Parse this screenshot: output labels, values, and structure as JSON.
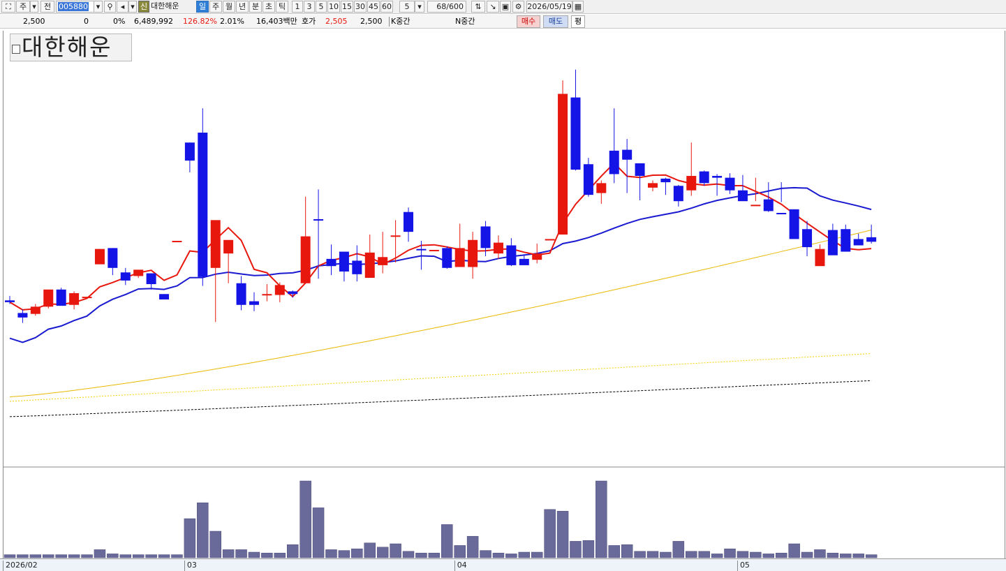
{
  "toolbar": {
    "period_label": "주",
    "view_label": "전",
    "code_value": "005880",
    "badge_label": "신",
    "stock_name": "대한해운",
    "timeframes": [
      "일",
      "주",
      "월",
      "년",
      "분",
      "초",
      "틱"
    ],
    "active_timeframe": "일",
    "intervals": [
      "1",
      "3",
      "5",
      "10",
      "15",
      "30",
      "45",
      "60"
    ],
    "interval_value": "5",
    "count_display": "68/600",
    "date_value": "2026/05/19"
  },
  "quote": {
    "price": "2,500",
    "change": "0",
    "change_rate": "0%",
    "volume": "6,489,992",
    "volume_ratio": "126.82%",
    "turnover": "2.01%",
    "amount": "16,403백만",
    "ask_label": "호가",
    "ask": "2,505",
    "bid": "2,500",
    "k_label": "K중간",
    "n_label": "N중간",
    "buy_label": "매수",
    "sell_label": "매도",
    "avg_label": "평"
  },
  "title": "대한해운",
  "colors": {
    "up": "#e8170e",
    "down": "#1414e6",
    "ma5": "#e8170e",
    "ma20": "#1a1ad0",
    "ma60": "#e8b800",
    "ma120": "#f5d000",
    "ma240": "#000000",
    "volume": "#6a6a9a"
  },
  "chart_data": {
    "type": "candlestick",
    "x_labels": [
      {
        "label": "2026/02",
        "index": 0
      },
      {
        "label": "03",
        "index": 14
      },
      {
        "label": "04",
        "index": 35
      },
      {
        "label": "05",
        "index": 57
      }
    ],
    "ohlc": [
      [
        2226,
        2231,
        2222,
        2224
      ],
      [
        2212,
        2216,
        2201,
        2207
      ],
      [
        2211,
        2222,
        2209,
        2219
      ],
      [
        2219,
        2238,
        2217,
        2238
      ],
      [
        2238,
        2240,
        2220,
        2220
      ],
      [
        2221,
        2236,
        2216,
        2234
      ],
      [
        2230,
        2230,
        2230,
        2230
      ],
      [
        2266,
        2283,
        2266,
        2283
      ],
      [
        2284,
        2284,
        2254,
        2262
      ],
      [
        2257,
        2262,
        2243,
        2248
      ],
      [
        2253,
        2260,
        2251,
        2260
      ],
      [
        2256,
        2256,
        2238,
        2244
      ],
      [
        2233,
        2233,
        2228,
        2227
      ],
      [
        2292,
        2292,
        2292,
        2292
      ],
      [
        2401,
        2401,
        2368,
        2381
      ],
      [
        2412,
        2439,
        2242,
        2252
      ],
      [
        2262,
        2291,
        2202,
        2315
      ],
      [
        2278,
        2281,
        2245,
        2293
      ],
      [
        2245,
        2253,
        2215,
        2221
      ],
      [
        2225,
        2235,
        2214,
        2221
      ],
      [
        2233,
        2244,
        2225,
        2233
      ],
      [
        2232,
        2246,
        2224,
        2243
      ],
      [
        2236,
        2237,
        2229,
        2233
      ],
      [
        2245,
        2341,
        2245,
        2297
      ],
      [
        2316,
        2349,
        2250,
        2315
      ],
      [
        2272,
        2288,
        2254,
        2264
      ],
      [
        2280,
        2280,
        2247,
        2258
      ],
      [
        2270,
        2287,
        2247,
        2255
      ],
      [
        2251,
        2299,
        2251,
        2279
      ],
      [
        2265,
        2302,
        2256,
        2274
      ],
      [
        2297,
        2315,
        2268,
        2298
      ],
      [
        2324,
        2329,
        2291,
        2302
      ],
      [
        2283,
        2292,
        2260,
        2282
      ],
      [
        2282,
        2282,
        2282,
        2282
      ],
      [
        2284,
        2286,
        2261,
        2262
      ],
      [
        2263,
        2311,
        2263,
        2284
      ],
      [
        2263,
        2302,
        2250,
        2293
      ],
      [
        2308,
        2314,
        2275,
        2284
      ],
      [
        2278,
        2298,
        2272,
        2290
      ],
      [
        2287,
        2295,
        2264,
        2265
      ],
      [
        2272,
        2277,
        2265,
        2265
      ],
      [
        2271,
        2289,
        2267,
        2278
      ],
      [
        2294,
        2294,
        2294,
        2294
      ],
      [
        2299,
        2470,
        2299,
        2455
      ],
      [
        2451,
        2482,
        2370,
        2371
      ],
      [
        2377,
        2384,
        2341,
        2343
      ],
      [
        2345,
        2359,
        2333,
        2356
      ],
      [
        2392,
        2439,
        2356,
        2366
      ],
      [
        2393,
        2405,
        2345,
        2382
      ],
      [
        2378,
        2378,
        2337,
        2364
      ],
      [
        2351,
        2359,
        2347,
        2356
      ],
      [
        2361,
        2362,
        2343,
        2357
      ],
      [
        2353,
        2354,
        2330,
        2336
      ],
      [
        2348,
        2401,
        2342,
        2364
      ],
      [
        2369,
        2370,
        2353,
        2356
      ],
      [
        2364,
        2366,
        2342,
        2362
      ],
      [
        2362,
        2367,
        2344,
        2348
      ],
      [
        2348,
        2365,
        2337,
        2336
      ],
      [
        2332,
        2362,
        2336,
        2332
      ],
      [
        2338,
        2357,
        2324,
        2325
      ],
      [
        2323,
        2357,
        2335,
        2322
      ],
      [
        2327,
        2327,
        2297,
        2294
      ],
      [
        2305,
        2314,
        2275,
        2285
      ],
      [
        2264,
        2288,
        2267,
        2283
      ],
      [
        2304,
        2311,
        2297,
        2276
      ],
      [
        2305,
        2310,
        2282,
        2280
      ],
      [
        2294,
        2300,
        2287,
        2287
      ],
      [
        2296,
        2310,
        2289,
        2291
      ]
    ],
    "volume_levels": [
      2,
      2,
      2,
      2,
      2,
      2,
      2,
      8,
      3,
      2,
      2,
      2,
      2,
      2,
      45,
      64,
      30,
      8,
      8,
      5,
      4,
      4,
      14,
      90,
      58,
      8,
      7,
      9,
      16,
      11,
      15,
      6,
      4,
      4,
      38,
      13,
      24,
      7,
      4,
      3,
      5,
      5,
      56,
      54,
      18,
      19,
      90,
      13,
      14,
      6,
      6,
      5,
      18,
      6,
      6,
      3,
      9,
      6,
      5,
      3,
      4,
      15,
      5,
      8,
      4,
      3,
      3,
      2
    ]
  }
}
